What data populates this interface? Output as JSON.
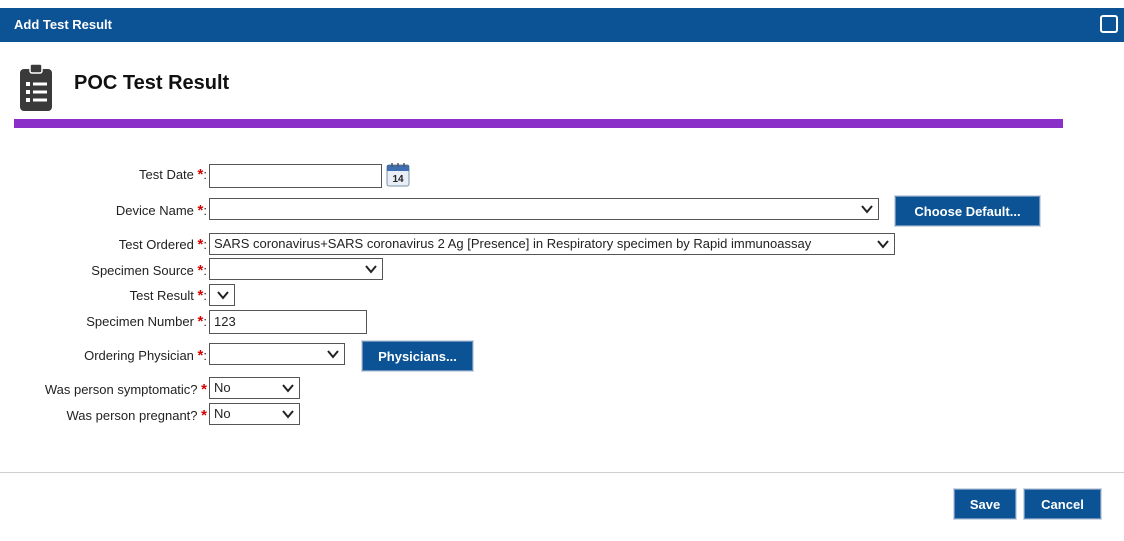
{
  "window": {
    "title": "Add Test Result"
  },
  "page": {
    "title": "POC Test Result",
    "accent_color": "#8b2fc9",
    "brand_color": "#0b5394"
  },
  "form": {
    "required_marker": "*",
    "colon": ":",
    "test_date": {
      "label": "Test Date",
      "value": ""
    },
    "device_name": {
      "label": "Device Name",
      "value": "",
      "button": "Choose Default..."
    },
    "test_ordered": {
      "label": "Test Ordered",
      "value": "SARS coronavirus+SARS coronavirus 2 Ag [Presence] in Respiratory specimen by Rapid immunoassay"
    },
    "specimen_source": {
      "label": "Specimen Source",
      "value": ""
    },
    "test_result": {
      "label": "Test Result",
      "value": ""
    },
    "specimen_number": {
      "label": "Specimen Number",
      "value": "123"
    },
    "ordering_physician": {
      "label": "Ordering Physician",
      "value": "",
      "button": "Physicians..."
    },
    "symptomatic": {
      "label": "Was person symptomatic?",
      "value": "No"
    },
    "pregnant": {
      "label": "Was person pregnant?",
      "value": "No"
    }
  },
  "calendar": {
    "day": "14"
  },
  "footer": {
    "save": "Save",
    "cancel": "Cancel"
  }
}
